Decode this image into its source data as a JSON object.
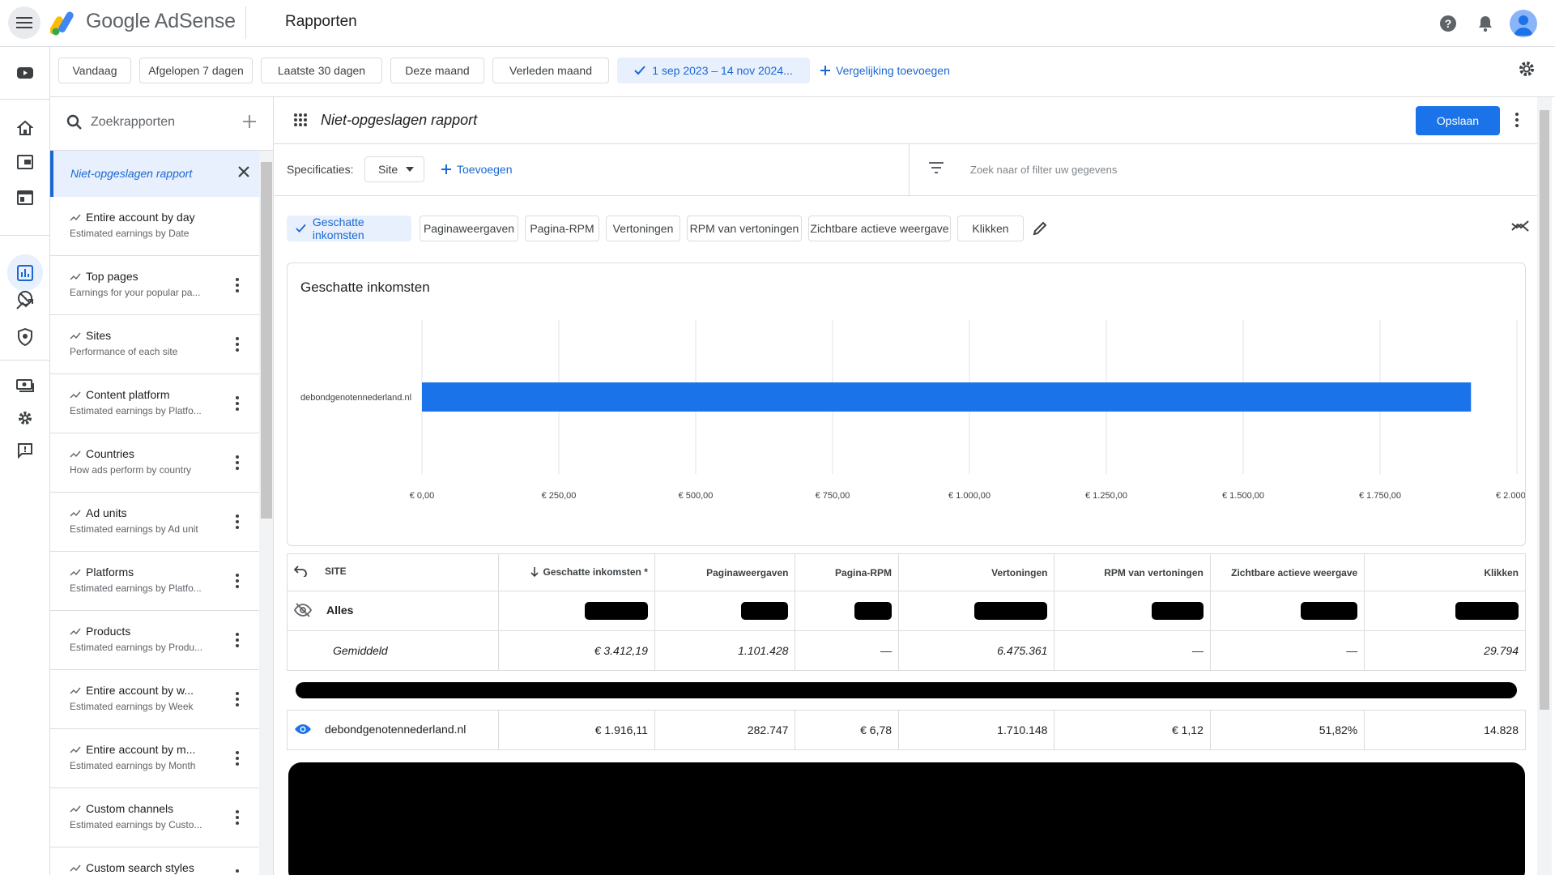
{
  "app": {
    "brand": "Google AdSense",
    "page_title": "Rapporten"
  },
  "date_ranges": [
    "Vandaag",
    "Afgelopen 7 dagen",
    "Laatste 30 dagen",
    "Deze maand",
    "Verleden maand"
  ],
  "date_selected": "1 sep 2023 – 14 nov 2024...",
  "add_comparison": "Vergelijking toevoegen",
  "sidebar": {
    "search_placeholder": "Zoekrapporten",
    "unsaved_report": "Niet-opgeslagen rapport",
    "reports": [
      {
        "title": "Entire account by day",
        "subtitle": "Estimated earnings by Date"
      },
      {
        "title": "Top pages",
        "subtitle": "Earnings for your popular pa..."
      },
      {
        "title": "Sites",
        "subtitle": "Performance of each site"
      },
      {
        "title": "Content platform",
        "subtitle": "Estimated earnings by Platfo..."
      },
      {
        "title": "Countries",
        "subtitle": "How ads perform by country"
      },
      {
        "title": "Ad units",
        "subtitle": "Estimated earnings by Ad unit"
      },
      {
        "title": "Platforms",
        "subtitle": "Estimated earnings by Platfo..."
      },
      {
        "title": "Products",
        "subtitle": "Estimated earnings by Produ..."
      },
      {
        "title": "Entire account by w...",
        "subtitle": "Estimated earnings by Week"
      },
      {
        "title": "Entire account by m...",
        "subtitle": "Estimated earnings by Month"
      },
      {
        "title": "Custom channels",
        "subtitle": "Estimated earnings by Custo..."
      },
      {
        "title": "Custom search styles",
        "subtitle": ""
      }
    ]
  },
  "report": {
    "name": "Niet-opgeslagen rapport",
    "save_label": "Opslaan",
    "specs_label": "Specificaties:",
    "spec_value": "Site",
    "add_spec": "Toevoegen",
    "filter_placeholder": "Zoek naar of filter uw gegevens",
    "metrics": [
      "Geschatte inkomsten",
      "Paginaweergaven",
      "Pagina-RPM",
      "Vertoningen",
      "RPM van vertoningen",
      "Zichtbare actieve weergave",
      "Klikken"
    ]
  },
  "chart_data": {
    "type": "bar",
    "orientation": "horizontal",
    "title": "Geschatte inkomsten",
    "categories": [
      "debondgenotennederland.nl"
    ],
    "values": [
      1916.11
    ],
    "xlim": [
      0,
      2000
    ],
    "ticks": [
      0,
      250,
      500,
      750,
      1000,
      1250,
      1500,
      1750,
      2000
    ],
    "tick_labels": [
      "€ 0,00",
      "€ 250,00",
      "€ 500,00",
      "€ 750,00",
      "€ 1.000,00",
      "€ 1.250,00",
      "€ 1.500,00",
      "€ 1.750,00",
      "€ 2.000,00"
    ],
    "grid": true,
    "color": "#1a73e8"
  },
  "table": {
    "headers": {
      "site": "SITE",
      "earnings": "Geschatte inkomsten *",
      "pageviews": "Paginaweergaven",
      "page_rpm": "Pagina-RPM",
      "impressions": "Vertoningen",
      "imp_rpm": "RPM van vertoningen",
      "active_view": "Zichtbare actieve weergave",
      "clicks": "Klikken"
    },
    "total_label": "Alles",
    "average": {
      "label": "Gemiddeld",
      "earnings": "€ 3.412,19",
      "pageviews": "1.101.428",
      "page_rpm": "—",
      "impressions": "6.475.361",
      "imp_rpm": "—",
      "active_view": "—",
      "clicks": "29.794"
    },
    "row": {
      "site": "debondgenotennederland.nl",
      "earnings": "€ 1.916,11",
      "pageviews": "282.747",
      "page_rpm": "€ 6,78",
      "impressions": "1.710.148",
      "imp_rpm": "€ 1,12",
      "active_view": "51,82%",
      "clicks": "14.828"
    }
  }
}
